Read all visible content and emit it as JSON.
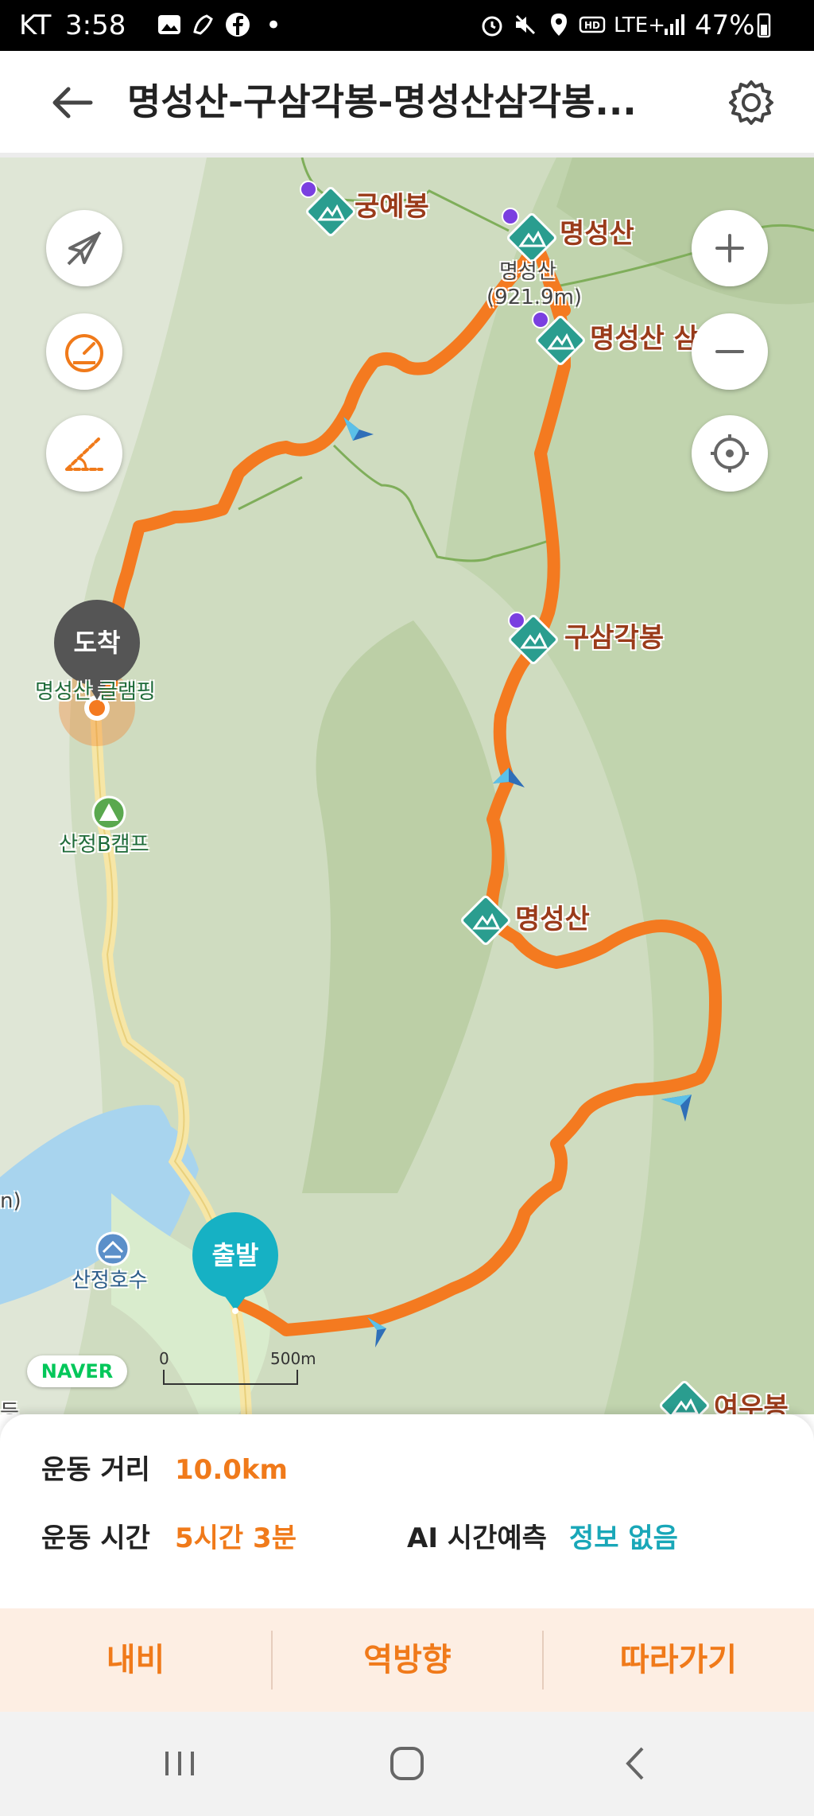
{
  "status_bar": {
    "carrier": "KT",
    "time": "3:58",
    "network": "LTE+",
    "battery": "47%",
    "dot": "•"
  },
  "header": {
    "title": "명성산-구삼각봉-명성산삼각봉...",
    "back_icon": "arrow-left-icon",
    "settings_icon": "gear-icon"
  },
  "map": {
    "route_color": "#f47a20",
    "peaks": [
      {
        "label": "궁예봉"
      },
      {
        "label": "명성산"
      },
      {
        "label": "명성산 삼…"
      },
      {
        "label": "구삼각봉"
      },
      {
        "label": "명성산"
      },
      {
        "label": "여우봉"
      }
    ],
    "elevation_label_1": "명성산",
    "elevation_label_2": "(921.9m)",
    "places": {
      "camping": "명성산 글램핑",
      "campsite": "산정B캠프",
      "lake": "산정호수"
    },
    "markers": {
      "arrival": "도착",
      "departure": "출발"
    },
    "edge_label_left": "n)",
    "edge_label_bottom": "등",
    "zoom_in": "+",
    "zoom_out": "−",
    "scale": {
      "zero": "0",
      "distance": "500m"
    },
    "attribution": "NAVER"
  },
  "stats": {
    "distance_label": "운동 거리",
    "distance_value": "10.0km",
    "time_label": "운동 시간",
    "time_value": "5시간 3분",
    "ai_label": "AI 시간예측",
    "ai_value": "정보 없음"
  },
  "actions": {
    "navi": "내비",
    "reverse": "역방향",
    "follow": "따라가기"
  },
  "colors": {
    "accent": "#f07a1a",
    "teal": "#19a7b8",
    "peak_icon": "#2a9d8f",
    "map_green": "#c9d8b6",
    "water": "#a8d4ee"
  }
}
